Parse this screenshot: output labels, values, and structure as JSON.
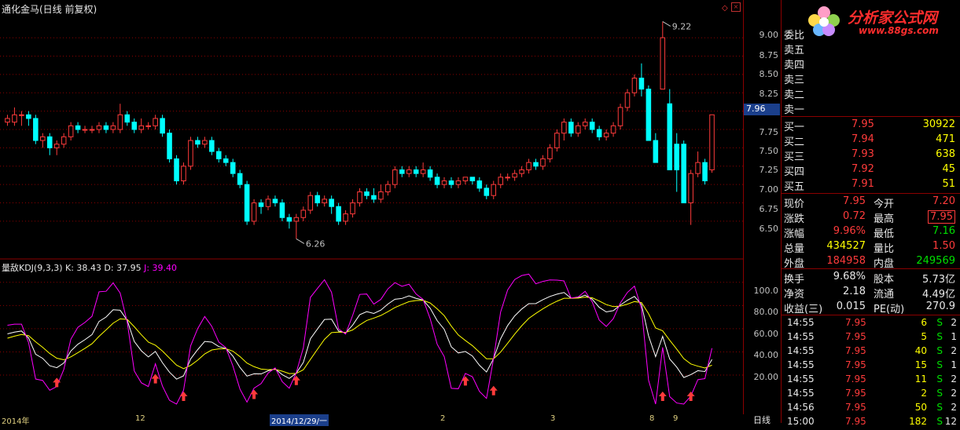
{
  "title": "通化金马(日线 前复权)",
  "price_axis": {
    "ticks": [
      "9.00",
      "8.75",
      "8.50",
      "8.25",
      "8.00",
      "7.75",
      "7.50",
      "7.25",
      "7.00",
      "6.75",
      "6.50"
    ]
  },
  "current_price_tag": "7.96",
  "annotations": {
    "high": "9.22",
    "low": "6.26"
  },
  "kdj": {
    "title_parts": [
      "量敌KDJ(9,3,3)",
      "K: 38.43",
      "D: 37.95",
      "J: 39.40"
    ],
    "axis_ticks": [
      "100.0",
      "80.00",
      "60.00",
      "40.00",
      "20.00"
    ]
  },
  "dates": [
    "2014年",
    "12",
    "2014/12/29/一",
    "2",
    "3",
    "8",
    "9"
  ],
  "period_tab": "日线",
  "logo": {
    "brand": "分析家公式网",
    "url": "www.88gs.com"
  },
  "order_book": {
    "committee": "委比",
    "sells": [
      "卖五",
      "卖四",
      "卖三",
      "卖二",
      "卖一"
    ],
    "buys": [
      {
        "label": "买一",
        "price": "7.95",
        "vol": "30922"
      },
      {
        "label": "买二",
        "price": "7.94",
        "vol": "471"
      },
      {
        "label": "买三",
        "price": "7.93",
        "vol": "638"
      },
      {
        "label": "买四",
        "price": "7.92",
        "vol": "45"
      },
      {
        "label": "买五",
        "price": "7.91",
        "vol": "51"
      }
    ]
  },
  "quote": {
    "rows": [
      {
        "l1": "现价",
        "v1": "7.95",
        "l2": "今开",
        "v2": "7.20"
      },
      {
        "l1": "涨跌",
        "v1": "0.72",
        "l2": "最高",
        "v2": "7.95"
      },
      {
        "l1": "涨幅",
        "v1": "9.96%",
        "l2": "最低",
        "v2": "7.16"
      },
      {
        "l1": "总量",
        "v1": "434527",
        "l2": "量比",
        "v2": "1.50"
      },
      {
        "l1": "外盘",
        "v1": "184958",
        "l2": "内盘",
        "v2": "249569"
      }
    ]
  },
  "fundamentals": {
    "rows": [
      {
        "l1": "换手",
        "v1": "9.68%",
        "l2": "股本",
        "v2": "5.73亿"
      },
      {
        "l1": "净资",
        "v1": "2.18",
        "l2": "流通",
        "v2": "4.49亿"
      },
      {
        "l1": "收益(三)",
        "v1": "0.015",
        "l2": "PE(动)",
        "v2": "270.9"
      }
    ]
  },
  "ticks": [
    {
      "time": "14:55",
      "price": "7.95",
      "vol": "6",
      "side": "S",
      "n": "2"
    },
    {
      "time": "14:55",
      "price": "7.95",
      "vol": "5",
      "side": "S",
      "n": "1"
    },
    {
      "time": "14:55",
      "price": "7.95",
      "vol": "40",
      "side": "S",
      "n": "2"
    },
    {
      "time": "14:55",
      "price": "7.95",
      "vol": "15",
      "side": "S",
      "n": "1"
    },
    {
      "time": "14:55",
      "price": "7.95",
      "vol": "11",
      "side": "S",
      "n": "2"
    },
    {
      "time": "14:55",
      "price": "7.95",
      "vol": "2",
      "side": "S",
      "n": "2"
    },
    {
      "time": "14:56",
      "price": "7.95",
      "vol": "50",
      "side": "S",
      "n": "2"
    },
    {
      "time": "15:00",
      "price": "7.95",
      "vol": "182",
      "side": "S",
      "n": "12"
    }
  ],
  "colors": {
    "up": "#ff3b3b",
    "down": "#00ffff",
    "k": "#ffffff",
    "d": "#ffff00",
    "j": "#ff00ff",
    "grid": "#8b0000"
  },
  "chart_data": {
    "type": "candlestick",
    "ylim": [
      6.2,
      9.3
    ],
    "candles": [
      [
        7.85,
        7.9,
        7.8,
        7.95
      ],
      [
        7.85,
        7.95,
        7.8,
        8.05
      ],
      [
        7.95,
        7.95,
        7.8,
        8.0
      ],
      [
        7.95,
        7.9,
        7.8,
        8.0
      ],
      [
        7.9,
        7.6,
        7.55,
        7.95
      ],
      [
        7.6,
        7.65,
        7.5,
        7.7
      ],
      [
        7.65,
        7.5,
        7.4,
        7.7
      ],
      [
        7.5,
        7.55,
        7.4,
        7.6
      ],
      [
        7.55,
        7.65,
        7.5,
        7.7
      ],
      [
        7.65,
        7.8,
        7.6,
        7.85
      ],
      [
        7.8,
        7.75,
        7.7,
        7.85
      ],
      [
        7.75,
        7.75,
        7.7,
        7.8
      ],
      [
        7.75,
        7.75,
        7.7,
        7.8
      ],
      [
        7.75,
        7.8,
        7.7,
        7.85
      ],
      [
        7.8,
        7.75,
        7.7,
        7.85
      ],
      [
        7.75,
        7.8,
        7.7,
        7.85
      ],
      [
        7.75,
        7.95,
        7.7,
        8.1
      ],
      [
        7.95,
        7.85,
        7.8,
        8.0
      ],
      [
        7.85,
        7.75,
        7.7,
        7.9
      ],
      [
        7.75,
        7.8,
        7.7,
        7.9
      ],
      [
        7.8,
        7.8,
        7.75,
        7.85
      ],
      [
        7.8,
        7.9,
        7.75,
        7.95
      ],
      [
        7.9,
        7.7,
        7.65,
        7.95
      ],
      [
        7.7,
        7.35,
        7.3,
        7.75
      ],
      [
        7.35,
        7.05,
        7.0,
        7.4
      ],
      [
        7.05,
        7.25,
        7.0,
        7.3
      ],
      [
        7.25,
        7.6,
        7.2,
        7.65
      ],
      [
        7.6,
        7.55,
        7.5,
        7.65
      ],
      [
        7.55,
        7.6,
        7.5,
        7.65
      ],
      [
        7.6,
        7.45,
        7.4,
        7.65
      ],
      [
        7.45,
        7.35,
        7.3,
        7.5
      ],
      [
        7.35,
        7.3,
        7.25,
        7.4
      ],
      [
        7.3,
        7.15,
        7.1,
        7.35
      ],
      [
        7.15,
        7.0,
        6.95,
        7.2
      ],
      [
        7.0,
        6.5,
        6.45,
        7.05
      ],
      [
        6.5,
        6.75,
        6.45,
        6.8
      ],
      [
        6.75,
        6.7,
        6.6,
        6.8
      ],
      [
        6.7,
        6.8,
        6.65,
        6.85
      ],
      [
        6.8,
        6.75,
        6.7,
        6.85
      ],
      [
        6.75,
        6.55,
        6.5,
        6.8
      ],
      [
        6.55,
        6.5,
        6.4,
        6.6
      ],
      [
        6.5,
        6.55,
        6.26,
        6.6
      ],
      [
        6.55,
        6.65,
        6.5,
        6.7
      ],
      [
        6.65,
        6.85,
        6.6,
        6.9
      ],
      [
        6.85,
        6.75,
        6.7,
        6.9
      ],
      [
        6.75,
        6.8,
        6.7,
        6.85
      ],
      [
        6.8,
        6.7,
        6.6,
        6.85
      ],
      [
        6.7,
        6.5,
        6.45,
        6.75
      ],
      [
        6.5,
        6.6,
        6.45,
        6.65
      ],
      [
        6.6,
        6.75,
        6.55,
        6.8
      ],
      [
        6.75,
        6.9,
        6.7,
        6.95
      ],
      [
        6.9,
        6.85,
        6.8,
        6.95
      ],
      [
        6.85,
        6.8,
        6.75,
        6.95
      ],
      [
        6.8,
        6.9,
        6.75,
        7.0
      ],
      [
        6.9,
        7.0,
        6.85,
        7.05
      ],
      [
        7.0,
        7.2,
        6.95,
        7.25
      ],
      [
        7.2,
        7.15,
        7.1,
        7.25
      ],
      [
        7.15,
        7.2,
        7.1,
        7.25
      ],
      [
        7.2,
        7.15,
        7.1,
        7.25
      ],
      [
        7.15,
        7.2,
        7.1,
        7.3
      ],
      [
        7.2,
        7.1,
        7.05,
        7.25
      ],
      [
        7.1,
        7.0,
        6.95,
        7.15
      ],
      [
        7.0,
        7.05,
        6.95,
        7.1
      ],
      [
        7.05,
        7.0,
        6.95,
        7.1
      ],
      [
        7.0,
        7.05,
        6.95,
        7.1
      ],
      [
        7.05,
        7.1,
        7.0,
        7.1
      ],
      [
        7.1,
        7.05,
        7.0,
        7.1
      ],
      [
        7.05,
        6.95,
        6.9,
        7.1
      ],
      [
        6.95,
        6.85,
        6.8,
        7.0
      ],
      [
        6.85,
        7.0,
        6.8,
        7.05
      ],
      [
        7.0,
        7.1,
        6.95,
        7.15
      ],
      [
        7.1,
        7.1,
        7.05,
        7.15
      ],
      [
        7.1,
        7.15,
        7.05,
        7.2
      ],
      [
        7.15,
        7.2,
        7.1,
        7.25
      ],
      [
        7.2,
        7.3,
        7.15,
        7.35
      ],
      [
        7.3,
        7.25,
        7.2,
        7.35
      ],
      [
        7.25,
        7.35,
        7.2,
        7.4
      ],
      [
        7.35,
        7.5,
        7.3,
        7.55
      ],
      [
        7.5,
        7.7,
        7.45,
        7.75
      ],
      [
        7.7,
        7.85,
        7.6,
        7.9
      ],
      [
        7.85,
        7.7,
        7.65,
        7.9
      ],
      [
        7.7,
        7.8,
        7.65,
        7.85
      ],
      [
        7.8,
        7.85,
        7.75,
        7.9
      ],
      [
        7.85,
        7.75,
        7.7,
        7.9
      ],
      [
        7.75,
        7.65,
        7.6,
        7.8
      ],
      [
        7.65,
        7.7,
        7.6,
        7.75
      ],
      [
        7.7,
        7.8,
        7.65,
        7.85
      ],
      [
        7.8,
        8.05,
        7.75,
        8.1
      ],
      [
        8.05,
        8.25,
        8.0,
        8.3
      ],
      [
        8.25,
        8.45,
        8.2,
        8.5
      ],
      [
        8.45,
        8.3,
        8.2,
        8.65
      ],
      [
        8.3,
        7.6,
        7.6,
        8.35
      ],
      [
        7.6,
        7.3,
        7.3,
        7.7
      ],
      [
        8.3,
        9.0,
        8.3,
        9.22
      ],
      [
        8.1,
        7.2,
        7.4,
        8.3
      ],
      [
        7.55,
        7.2,
        6.9,
        7.7
      ],
      [
        7.55,
        6.75,
        6.75,
        7.6
      ],
      [
        6.75,
        7.15,
        6.45,
        7.2
      ],
      [
        7.15,
        7.3,
        7.1,
        7.45
      ],
      [
        7.3,
        7.05,
        7.0,
        7.35
      ],
      [
        7.2,
        7.95,
        7.16,
        7.95
      ]
    ]
  }
}
